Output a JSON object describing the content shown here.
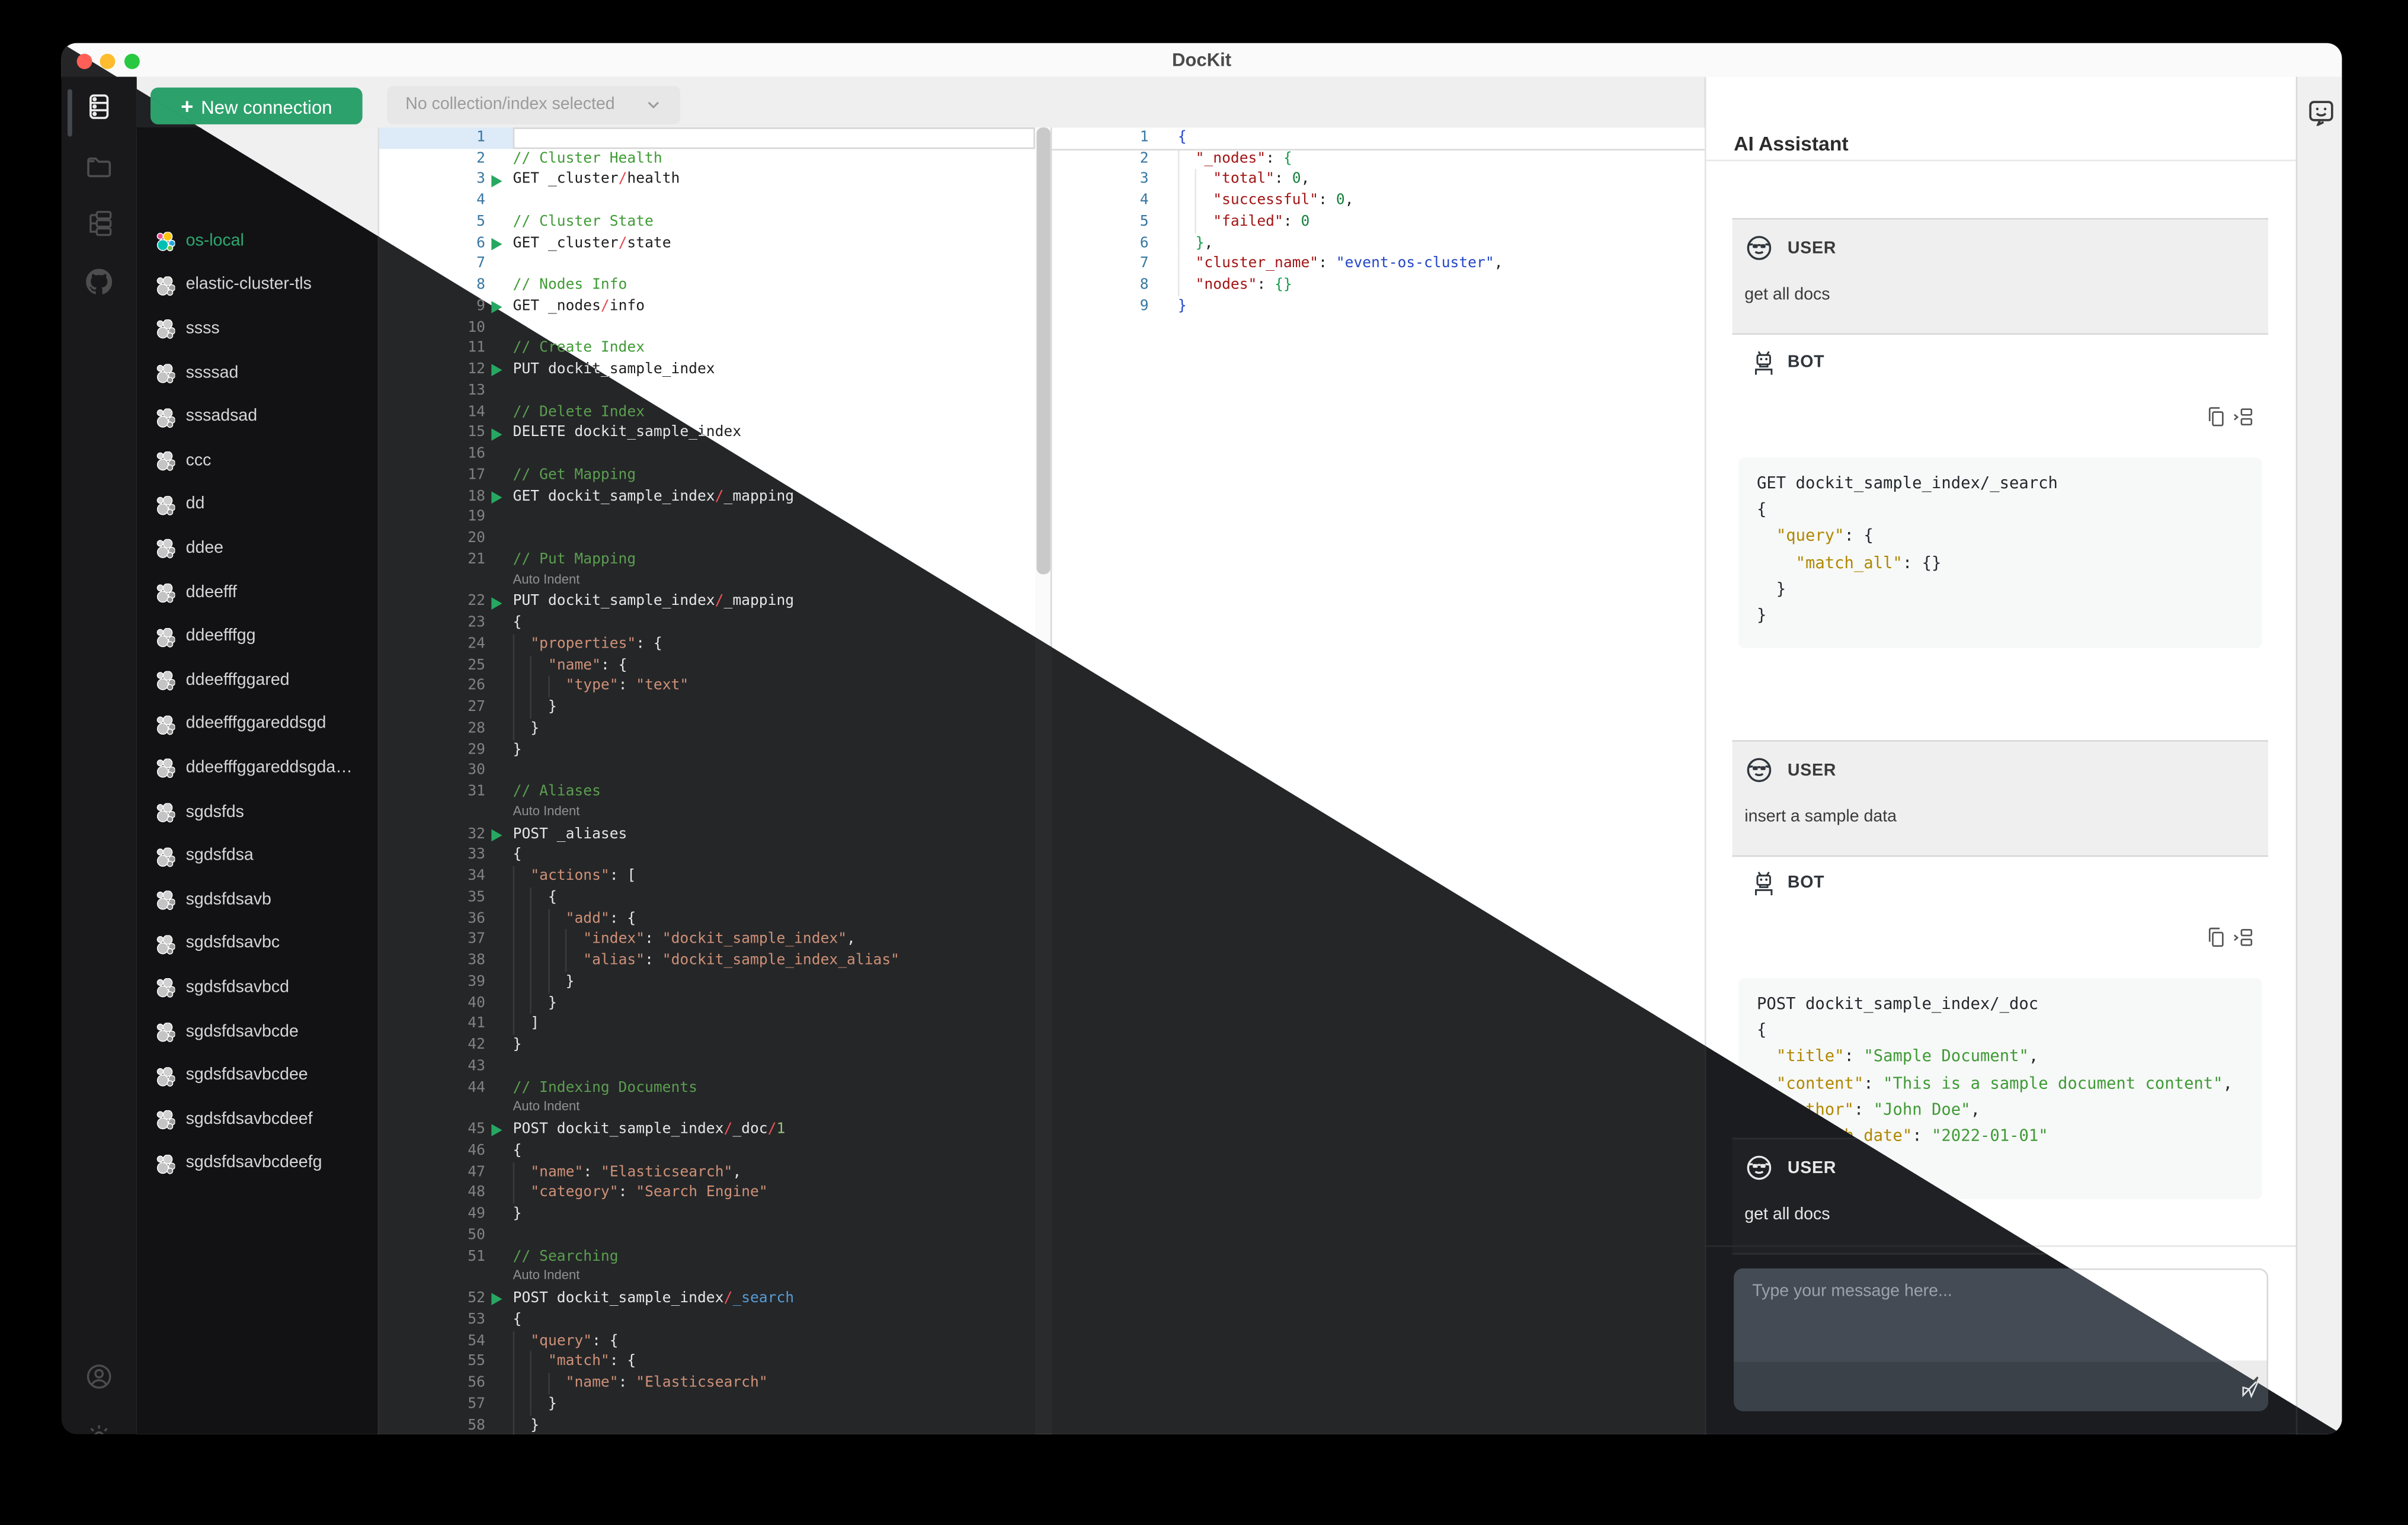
{
  "window": {
    "title": "DocKit"
  },
  "colors": {
    "accent_green": "#2da16c",
    "active_connection": "#2ea86f",
    "run_arrow": "#27a862",
    "traffic": [
      "#ff5f57",
      "#febc2e",
      "#28c840"
    ]
  },
  "toolbar": {
    "new_connection_label": "New connection",
    "collection_select_value": "No collection/index selected"
  },
  "rail": {
    "icons": [
      "server-icon",
      "folder-icon",
      "tree-icon",
      "github-icon"
    ],
    "bottom_icons": [
      "user-icon",
      "gear-icon"
    ]
  },
  "connections": {
    "items": [
      {
        "name": "os-local",
        "active": true
      },
      {
        "name": "elastic-cluster-tls"
      },
      {
        "name": "ssss"
      },
      {
        "name": "ssssad"
      },
      {
        "name": "sssadsad"
      },
      {
        "name": "ccc"
      },
      {
        "name": "dd"
      },
      {
        "name": "ddee"
      },
      {
        "name": "ddeefff"
      },
      {
        "name": "ddeefffgg"
      },
      {
        "name": "ddeefffggared"
      },
      {
        "name": "ddeefffggareddsgd"
      },
      {
        "name": "ddeefffggareddsgda…"
      },
      {
        "name": "sgdsfds"
      },
      {
        "name": "sgdsfdsa"
      },
      {
        "name": "sgdsfdsavb"
      },
      {
        "name": "sgdsfdsavbc"
      },
      {
        "name": "sgdsfdsavbcd"
      },
      {
        "name": "sgdsfdsavbcde"
      },
      {
        "name": "sgdsfdsavbcdee"
      },
      {
        "name": "sgdsfdsavbcdeef"
      },
      {
        "name": "sgdsfdsavbcdeefg"
      }
    ]
  },
  "editor": {
    "widget_label": "Auto Indent",
    "rows": [
      {
        "n": 1,
        "toks": []
      },
      {
        "n": 2,
        "toks": [
          [
            "c",
            "// Cluster Health"
          ]
        ]
      },
      {
        "n": 3,
        "run": true,
        "toks": [
          [
            "p",
            "GET _cluster"
          ],
          [
            "sl",
            "/"
          ],
          [
            "p",
            "health"
          ]
        ]
      },
      {
        "n": 4,
        "toks": []
      },
      {
        "n": 5,
        "toks": [
          [
            "c",
            "// Cluster State"
          ]
        ]
      },
      {
        "n": 6,
        "run": true,
        "toks": [
          [
            "p",
            "GET _cluster"
          ],
          [
            "sl",
            "/"
          ],
          [
            "p",
            "state"
          ]
        ]
      },
      {
        "n": 7,
        "toks": []
      },
      {
        "n": 8,
        "toks": [
          [
            "c",
            "// Nodes Info"
          ]
        ]
      },
      {
        "n": 9,
        "run": true,
        "toks": [
          [
            "p",
            "GET _nodes"
          ],
          [
            "sl",
            "/"
          ],
          [
            "p",
            "info"
          ]
        ]
      },
      {
        "n": 10,
        "toks": []
      },
      {
        "n": 11,
        "toks": [
          [
            "c",
            "// Create Index"
          ]
        ]
      },
      {
        "n": 12,
        "run": true,
        "toks": [
          [
            "p",
            "PUT dockit_sample_index"
          ]
        ]
      },
      {
        "n": 13,
        "toks": []
      },
      {
        "n": 14,
        "toks": [
          [
            "c",
            "// Delete Index"
          ]
        ]
      },
      {
        "n": 15,
        "run": true,
        "toks": [
          [
            "p",
            "DELETE dockit_sample_index"
          ]
        ]
      },
      {
        "n": 16,
        "toks": []
      },
      {
        "n": 17,
        "toks": [
          [
            "c",
            "// Get Mapping"
          ]
        ]
      },
      {
        "n": 18,
        "run": true,
        "toks": [
          [
            "p",
            "GET dockit_sample_index"
          ],
          [
            "sl",
            "/"
          ],
          [
            "p",
            "_mapping"
          ]
        ]
      },
      {
        "n": 19,
        "toks": []
      },
      {
        "n": 20,
        "toks": []
      },
      {
        "n": 21,
        "toks": [
          [
            "c",
            "// Put Mapping"
          ]
        ]
      },
      {
        "widget": true
      },
      {
        "n": 22,
        "run": true,
        "toks": [
          [
            "p",
            "PUT dockit_sample_index"
          ],
          [
            "sl",
            "/"
          ],
          [
            "p",
            "_mapping"
          ]
        ]
      },
      {
        "n": 23,
        "toks": [
          [
            "p",
            "{"
          ]
        ]
      },
      {
        "n": 24,
        "toks": [
          [
            "p",
            "  "
          ],
          [
            "k",
            "\"properties\""
          ],
          [
            "p",
            ": {"
          ]
        ]
      },
      {
        "n": 25,
        "toks": [
          [
            "p",
            "    "
          ],
          [
            "k",
            "\"name\""
          ],
          [
            "p",
            ": {"
          ]
        ]
      },
      {
        "n": 26,
        "toks": [
          [
            "p",
            "      "
          ],
          [
            "k",
            "\"type\""
          ],
          [
            "p",
            ": "
          ],
          [
            "s",
            "\"text\""
          ]
        ]
      },
      {
        "n": 27,
        "toks": [
          [
            "p",
            "    }"
          ]
        ]
      },
      {
        "n": 28,
        "toks": [
          [
            "p",
            "  }"
          ]
        ]
      },
      {
        "n": 29,
        "toks": [
          [
            "p",
            "}"
          ]
        ]
      },
      {
        "n": 30,
        "toks": []
      },
      {
        "n": 31,
        "toks": [
          [
            "c",
            "// Aliases"
          ]
        ]
      },
      {
        "widget": true
      },
      {
        "n": 32,
        "run": true,
        "toks": [
          [
            "p",
            "POST _aliases"
          ]
        ]
      },
      {
        "n": 33,
        "toks": [
          [
            "p",
            "{"
          ]
        ]
      },
      {
        "n": 34,
        "toks": [
          [
            "p",
            "  "
          ],
          [
            "k",
            "\"actions\""
          ],
          [
            "p",
            ": ["
          ]
        ]
      },
      {
        "n": 35,
        "toks": [
          [
            "p",
            "    {"
          ]
        ]
      },
      {
        "n": 36,
        "toks": [
          [
            "p",
            "      "
          ],
          [
            "k",
            "\"add\""
          ],
          [
            "p",
            ": {"
          ]
        ]
      },
      {
        "n": 37,
        "toks": [
          [
            "p",
            "        "
          ],
          [
            "k",
            "\"index\""
          ],
          [
            "p",
            ": "
          ],
          [
            "s",
            "\"dockit_sample_index\""
          ],
          [
            "p",
            ","
          ]
        ]
      },
      {
        "n": 38,
        "toks": [
          [
            "p",
            "        "
          ],
          [
            "k",
            "\"alias\""
          ],
          [
            "p",
            ": "
          ],
          [
            "s",
            "\"dockit_sample_index_alias\""
          ]
        ]
      },
      {
        "n": 39,
        "toks": [
          [
            "p",
            "      }"
          ]
        ]
      },
      {
        "n": 40,
        "toks": [
          [
            "p",
            "    }"
          ]
        ]
      },
      {
        "n": 41,
        "toks": [
          [
            "p",
            "  ]"
          ]
        ]
      },
      {
        "n": 42,
        "toks": [
          [
            "p",
            "}"
          ]
        ]
      },
      {
        "n": 43,
        "toks": []
      },
      {
        "n": 44,
        "toks": [
          [
            "c",
            "// Indexing Documents"
          ]
        ]
      },
      {
        "widget": true
      },
      {
        "n": 45,
        "run": true,
        "toks": [
          [
            "p",
            "POST dockit_sample_index"
          ],
          [
            "sl",
            "/"
          ],
          [
            "p",
            "_doc"
          ],
          [
            "sl",
            "/"
          ],
          [
            "n",
            "1"
          ]
        ]
      },
      {
        "n": 46,
        "toks": [
          [
            "p",
            "{"
          ]
        ]
      },
      {
        "n": 47,
        "toks": [
          [
            "p",
            "  "
          ],
          [
            "k",
            "\"name\""
          ],
          [
            "p",
            ": "
          ],
          [
            "s",
            "\"Elasticsearch\""
          ],
          [
            "p",
            ","
          ]
        ]
      },
      {
        "n": 48,
        "toks": [
          [
            "p",
            "  "
          ],
          [
            "k",
            "\"category\""
          ],
          [
            "p",
            ": "
          ],
          [
            "s",
            "\"Search Engine\""
          ]
        ]
      },
      {
        "n": 49,
        "toks": [
          [
            "p",
            "}"
          ]
        ]
      },
      {
        "n": 50,
        "toks": []
      },
      {
        "n": 51,
        "toks": [
          [
            "c",
            "// Searching"
          ]
        ]
      },
      {
        "widget": true
      },
      {
        "n": 52,
        "run": true,
        "toks": [
          [
            "p",
            "POST dockit_sample_index"
          ],
          [
            "sl",
            "/"
          ],
          [
            "bl",
            "_search"
          ]
        ]
      },
      {
        "n": 53,
        "toks": [
          [
            "p",
            "{"
          ]
        ]
      },
      {
        "n": 54,
        "toks": [
          [
            "p",
            "  "
          ],
          [
            "k",
            "\"query\""
          ],
          [
            "p",
            ": {"
          ]
        ]
      },
      {
        "n": 55,
        "toks": [
          [
            "p",
            "    "
          ],
          [
            "k",
            "\"match\""
          ],
          [
            "p",
            ": {"
          ]
        ]
      },
      {
        "n": 56,
        "toks": [
          [
            "p",
            "      "
          ],
          [
            "k",
            "\"name\""
          ],
          [
            "p",
            ": "
          ],
          [
            "s",
            "\"Elasticsearch\""
          ]
        ]
      },
      {
        "n": 57,
        "toks": [
          [
            "p",
            "    }"
          ]
        ]
      },
      {
        "n": 58,
        "toks": [
          [
            "p",
            "  }"
          ]
        ]
      }
    ]
  },
  "response": {
    "rows": [
      {
        "n": 1,
        "toks": [
          [
            "b0",
            "{"
          ]
        ]
      },
      {
        "n": 2,
        "toks": [
          [
            "p",
            "  "
          ],
          [
            "k",
            "\"_nodes\""
          ],
          [
            "p",
            ": "
          ],
          [
            "b1",
            "{"
          ]
        ]
      },
      {
        "n": 3,
        "toks": [
          [
            "p",
            "    "
          ],
          [
            "k",
            "\"total\""
          ],
          [
            "p",
            ": "
          ],
          [
            "n",
            "0"
          ],
          [
            "p",
            ","
          ]
        ]
      },
      {
        "n": 4,
        "toks": [
          [
            "p",
            "    "
          ],
          [
            "k",
            "\"successful\""
          ],
          [
            "p",
            ": "
          ],
          [
            "n",
            "0"
          ],
          [
            "p",
            ","
          ]
        ]
      },
      {
        "n": 5,
        "toks": [
          [
            "p",
            "    "
          ],
          [
            "k",
            "\"failed\""
          ],
          [
            "p",
            ": "
          ],
          [
            "n",
            "0"
          ]
        ]
      },
      {
        "n": 6,
        "toks": [
          [
            "p",
            "  "
          ],
          [
            "b1",
            "}"
          ],
          [
            "p",
            ","
          ]
        ]
      },
      {
        "n": 7,
        "toks": [
          [
            "p",
            "  "
          ],
          [
            "k",
            "\"cluster_name\""
          ],
          [
            "p",
            ": "
          ],
          [
            "s",
            "\"event-os-cluster\""
          ],
          [
            "p",
            ","
          ]
        ]
      },
      {
        "n": 8,
        "toks": [
          [
            "p",
            "  "
          ],
          [
            "k",
            "\"nodes\""
          ],
          [
            "p",
            ": "
          ],
          [
            "b1",
            "{}"
          ]
        ]
      },
      {
        "n": 9,
        "toks": [
          [
            "b0",
            "}"
          ]
        ]
      }
    ]
  },
  "assistant": {
    "title": "AI Assistant",
    "user_label": "USER",
    "bot_label": "BOT",
    "messages": {
      "user1": "get all docs",
      "user2": "insert a sample data",
      "user3": "get all docs"
    },
    "bot_code_1": [
      [
        [
          "cp",
          "GET dockit_sample_index/_search"
        ]
      ],
      [
        [
          "cp",
          "{"
        ]
      ],
      [
        [
          "cp",
          "  "
        ],
        [
          "ck",
          "\"query\""
        ],
        [
          "cp",
          ": {"
        ]
      ],
      [
        [
          "cp",
          "    "
        ],
        [
          "ck",
          "\"match_all\""
        ],
        [
          "cp",
          ": {}"
        ]
      ],
      [
        [
          "cp",
          "  }"
        ]
      ],
      [
        [
          "cp",
          "}"
        ]
      ]
    ],
    "bot_code_2": [
      [
        [
          "cp",
          "POST dockit_sample_index/_doc"
        ]
      ],
      [
        [
          "cp",
          "{"
        ]
      ],
      [
        [
          "cp",
          "  "
        ],
        [
          "ck",
          "\"title\""
        ],
        [
          "cp",
          ": "
        ],
        [
          "cs",
          "\"Sample Document\""
        ],
        [
          "cp",
          ","
        ]
      ],
      [
        [
          "cp",
          "  "
        ],
        [
          "ck",
          "\"content\""
        ],
        [
          "cp",
          ": "
        ],
        [
          "cs",
          "\"This is a sample document content\""
        ],
        [
          "cp",
          ","
        ]
      ],
      [
        [
          "cp",
          "  "
        ],
        [
          "ck",
          "\"author\""
        ],
        [
          "cp",
          ": "
        ],
        [
          "cs",
          "\"John Doe\""
        ],
        [
          "cp",
          ","
        ]
      ],
      [
        [
          "cp",
          "  "
        ],
        [
          "ck",
          "\"publish_date\""
        ],
        [
          "cp",
          ": "
        ],
        [
          "cs",
          "\"2022-01-01\""
        ]
      ],
      [
        [
          "cp",
          "}"
        ]
      ]
    ],
    "input_placeholder": "Type your message here..."
  }
}
